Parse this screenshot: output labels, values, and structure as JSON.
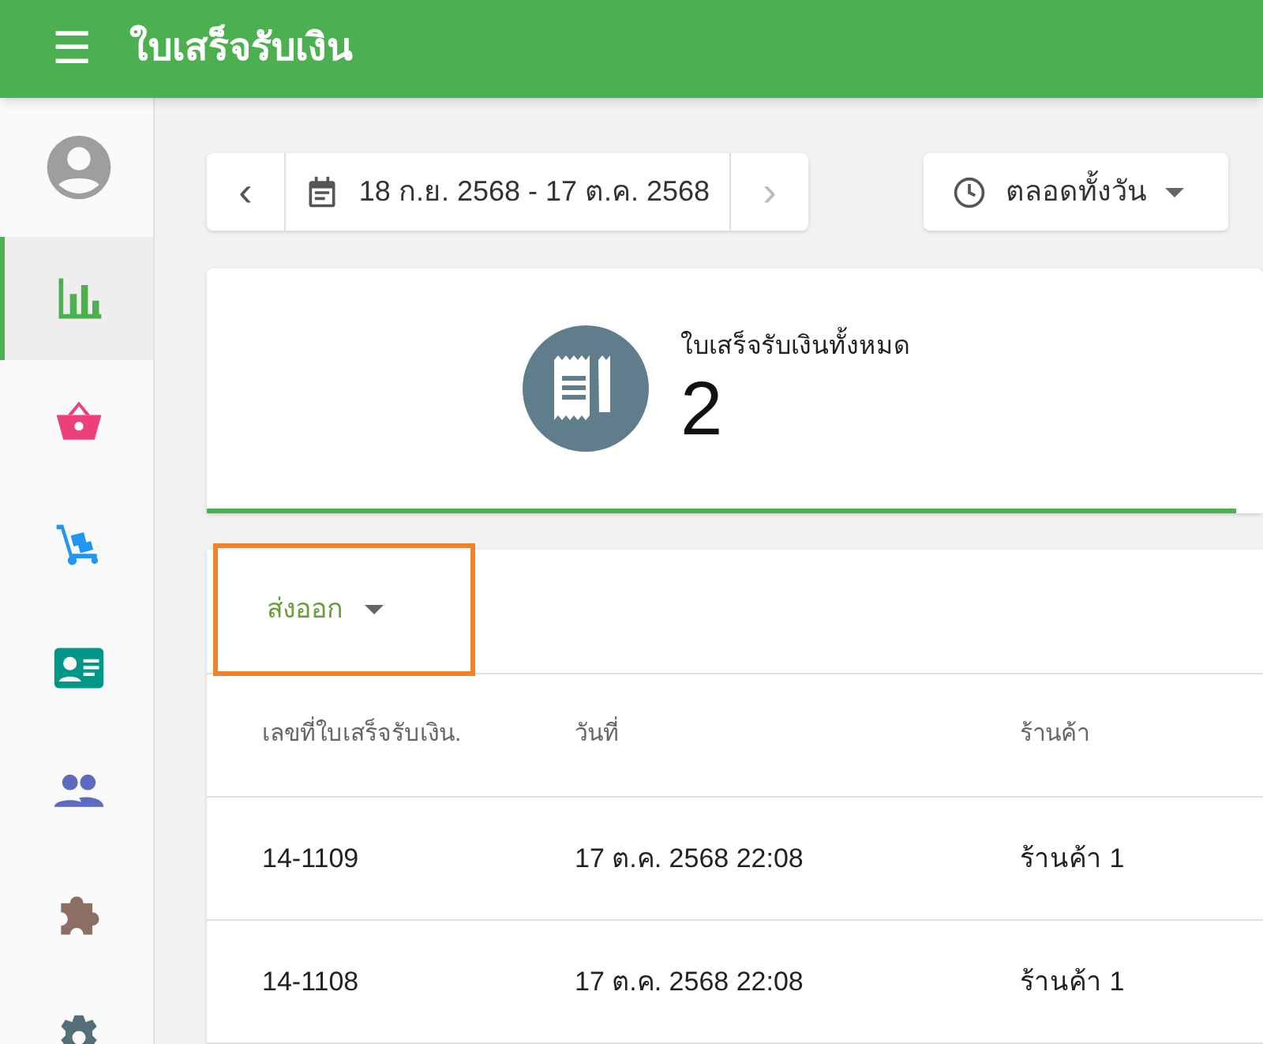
{
  "app_bar": {
    "menu_icon": "☰",
    "title": "ใบเสร็จรับเงิน"
  },
  "sidebar": {
    "items": [
      {
        "kind": "avatar",
        "selected": false,
        "color": "#9e9e9e"
      },
      {
        "kind": "chart",
        "selected": true,
        "color": "#4caf50"
      },
      {
        "kind": "basket",
        "selected": false,
        "color": "#ec407a"
      },
      {
        "kind": "cart",
        "selected": false,
        "color": "#2196f3"
      },
      {
        "kind": "card",
        "selected": false,
        "color": "#009688"
      },
      {
        "kind": "people",
        "selected": false,
        "color": "#5c6bc0"
      },
      {
        "kind": "puzzle",
        "selected": false,
        "color": "#8d6e63"
      },
      {
        "kind": "gear",
        "selected": false,
        "color": "#546e7a"
      }
    ]
  },
  "date_range": {
    "prev": "‹",
    "label": "18 ก.ย. 2568 - 17 ต.ค. 2568",
    "next": "›",
    "next_disabled": true
  },
  "time_filter": {
    "label": "ตลอดทั้งวัน"
  },
  "summary": {
    "label": "ใบเสร็จรับเงินทั้งหมด",
    "value": "2"
  },
  "export_button": {
    "label": "ส่งออก",
    "highlighted": true
  },
  "table": {
    "columns": [
      "เลขที่ใบเสร็จรับเงิน.",
      "วันที่",
      "ร้านค้า"
    ],
    "rows": [
      [
        "14-1109",
        "17 ต.ค. 2568 22:08",
        "ร้านค้า 1"
      ],
      [
        "14-1108",
        "17 ต.ค. 2568 22:08",
        "ร้านค้า 1"
      ]
    ]
  }
}
